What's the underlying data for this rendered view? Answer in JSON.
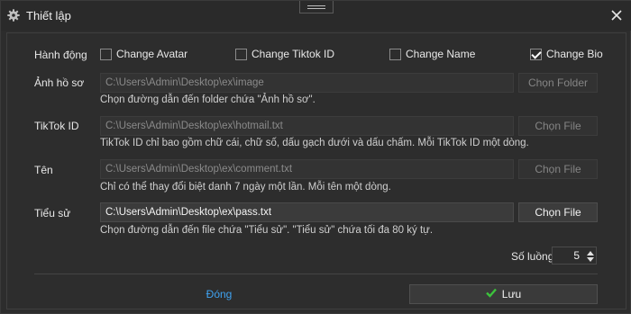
{
  "window": {
    "title": "Thiết lập"
  },
  "actions": {
    "label": "Hành động",
    "options": [
      {
        "label": "Change Avatar",
        "checked": false
      },
      {
        "label": "Change Tiktok ID",
        "checked": false
      },
      {
        "label": "Change Name",
        "checked": false
      },
      {
        "label": "Change Bio",
        "checked": true
      }
    ]
  },
  "rows": [
    {
      "label": "Ảnh hồ sơ",
      "value": "C:\\Users\\Admin\\Desktop\\ex\\image",
      "button": "Chọn Folder",
      "hint": "Chọn đường dẫn đến folder chứa \"Ảnh hồ sơ\".",
      "enabled": false
    },
    {
      "label": "TikTok ID",
      "value": "C:\\Users\\Admin\\Desktop\\ex\\hotmail.txt",
      "button": "Chọn File",
      "hint": "TikTok ID chỉ bao gồm chữ cái, chữ số, dấu gạch dưới và dấu chấm. Mỗi TikTok ID một dòng.",
      "enabled": false
    },
    {
      "label": "Tên",
      "value": "C:\\Users\\Admin\\Desktop\\ex\\comment.txt",
      "button": "Chọn File",
      "hint": "Chỉ có thể thay đổi biệt danh 7 ngày một lần. Mỗi tên một dòng.",
      "enabled": false
    },
    {
      "label": "Tiểu sử",
      "value": "C:\\Users\\Admin\\Desktop\\ex\\pass.txt",
      "button": "Chọn File",
      "hint": "Chọn đường dẫn đến file chứa \"Tiểu sử\". \"Tiểu sử\" chứa tối đa 80 ký tự.",
      "enabled": true
    }
  ],
  "count": {
    "label": "Số luồng",
    "value": "5"
  },
  "footer": {
    "close_label": "Đóng",
    "save_label": "Lưu"
  },
  "colors": {
    "accent_link": "#3fa2f0",
    "check_green": "#3cc23c"
  }
}
